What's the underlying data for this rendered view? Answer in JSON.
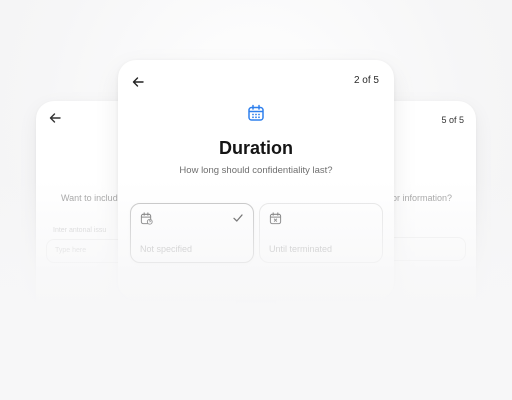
{
  "left_card": {
    "question_partial": "Want to include",
    "faint_label": "Inter antonal issu",
    "faint_input": "Type here"
  },
  "right_card": {
    "step_text": "5 of 5",
    "question_partial": "or information?"
  },
  "main_card": {
    "step_text": "2 of 5",
    "title": "Duration",
    "subtitle": "How long should confidentiality last?",
    "options": [
      {
        "label": "Not specified",
        "icon": "calendar-question-icon",
        "selected": true
      },
      {
        "label": "Until terminated",
        "icon": "calendar-x-icon",
        "selected": false
      }
    ],
    "header_icon": "calendar-icon"
  },
  "colors": {
    "accent": "#2f80ed",
    "selected_border": "#bdbdbd",
    "muted_text": "#9c9c9c",
    "background": "#f7f7f8"
  }
}
